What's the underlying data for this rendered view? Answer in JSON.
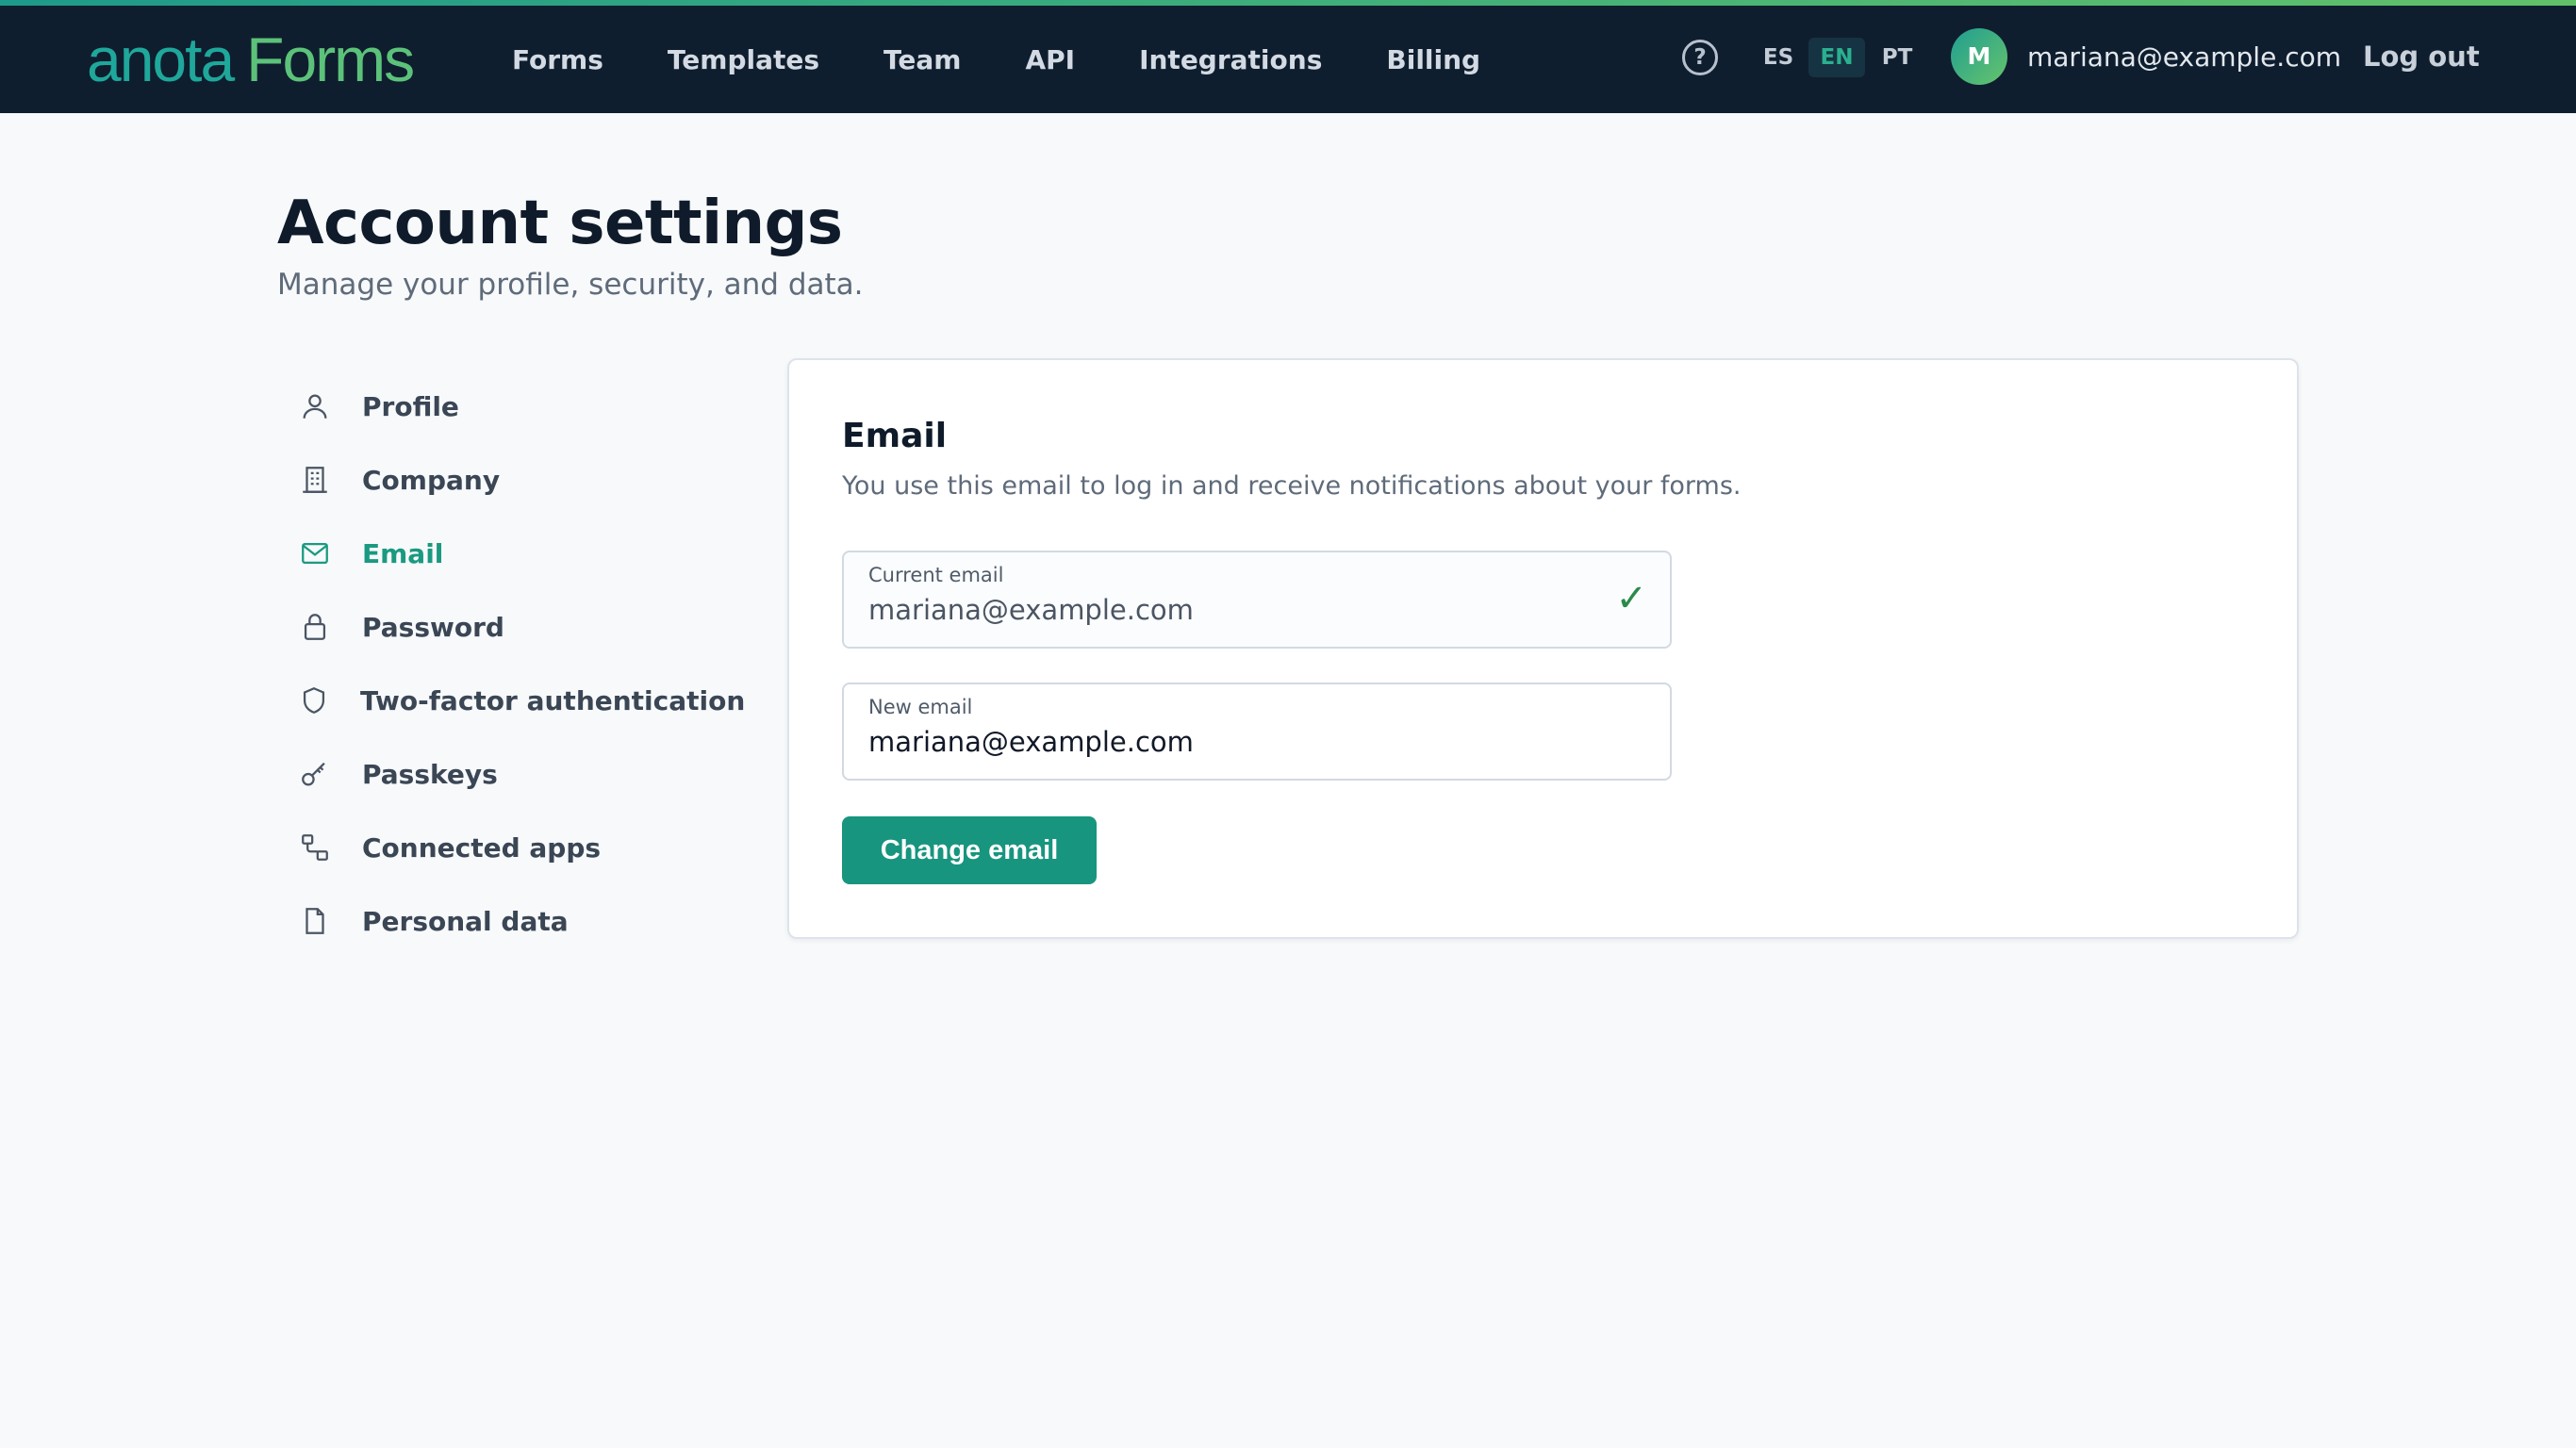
{
  "brand": {
    "part1": "anota",
    "part2": "Forms"
  },
  "nav": {
    "items": [
      "Forms",
      "Templates",
      "Team",
      "API",
      "Integrations",
      "Billing"
    ]
  },
  "header": {
    "help_glyph": "?",
    "languages": [
      "ES",
      "EN",
      "PT"
    ],
    "active_language": "EN",
    "avatar_initial": "M",
    "user_email": "mariana@example.com",
    "logout_label": "Log out"
  },
  "page": {
    "title": "Account settings",
    "subtitle": "Manage your profile, security, and data."
  },
  "sidebar": {
    "items": [
      {
        "label": "Profile",
        "icon": "user-icon"
      },
      {
        "label": "Company",
        "icon": "building-icon"
      },
      {
        "label": "Email",
        "icon": "mail-icon",
        "active": true
      },
      {
        "label": "Password",
        "icon": "lock-icon"
      },
      {
        "label": "Two-factor authentication",
        "icon": "shield-icon"
      },
      {
        "label": "Passkeys",
        "icon": "key-icon"
      },
      {
        "label": "Connected apps",
        "icon": "connected-apps-icon"
      },
      {
        "label": "Personal data",
        "icon": "document-icon"
      }
    ]
  },
  "email_card": {
    "title": "Email",
    "description": "You use this email to log in and receive notifications about your forms.",
    "current_label": "Current email",
    "current_value": "mariana@example.com",
    "new_label": "New email",
    "new_value": "mariana@example.com",
    "button_label": "Change email"
  },
  "colors": {
    "accent": "#17957f",
    "header_bg": "#0f1e2e",
    "active_nav": "#1a9a80"
  }
}
